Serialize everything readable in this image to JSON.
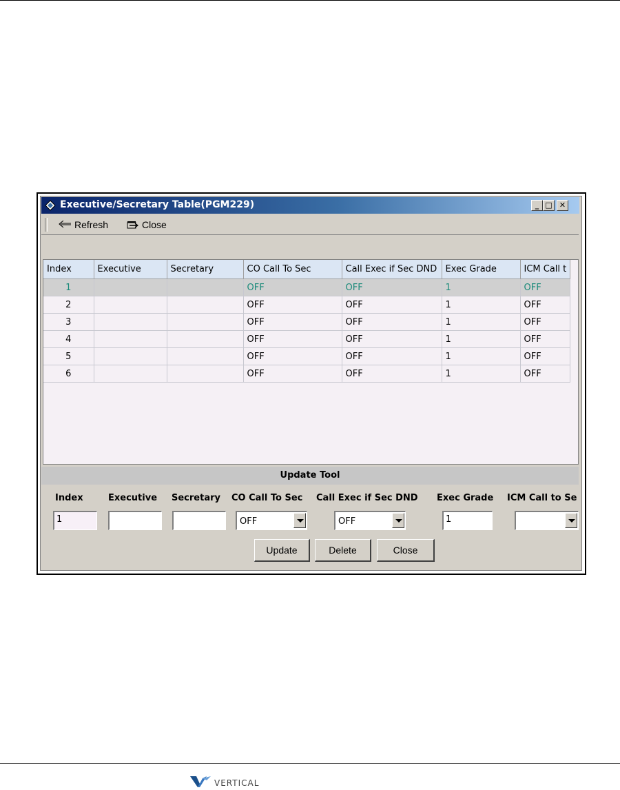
{
  "window": {
    "title": "Executive/Secretary Table(PGM229)",
    "buttons": {
      "minimize": "_",
      "maximize": "□",
      "close": "✕"
    }
  },
  "toolbar": {
    "refresh_label": "Refresh",
    "close_label": "Close"
  },
  "grid": {
    "columns": [
      "Index",
      "Executive",
      "Secretary",
      "CO Call To Sec",
      "Call Exec if Sec DND",
      "Exec Grade",
      "ICM Call t"
    ],
    "rows": [
      [
        "1",
        "",
        "",
        "OFF",
        "OFF",
        "1",
        "OFF"
      ],
      [
        "2",
        "",
        "",
        "OFF",
        "OFF",
        "1",
        "OFF"
      ],
      [
        "3",
        "",
        "",
        "OFF",
        "OFF",
        "1",
        "OFF"
      ],
      [
        "4",
        "",
        "",
        "OFF",
        "OFF",
        "1",
        "OFF"
      ],
      [
        "5",
        "",
        "",
        "OFF",
        "OFF",
        "1",
        "OFF"
      ],
      [
        "6",
        "",
        "",
        "OFF",
        "OFF",
        "1",
        "OFF"
      ]
    ],
    "selected_row": 1,
    "selected_color": "#1a8a7a"
  },
  "update_tool": {
    "title": "Update Tool",
    "labels": {
      "index": "Index",
      "executive": "Executive",
      "secretary": "Secretary",
      "co_call_to_sec": "CO Call To Sec",
      "call_exec_if_sec_dnd": "Call Exec if Sec DND",
      "exec_grade": "Exec Grade",
      "icm_call_to_sec": "ICM Call to Se"
    },
    "values": {
      "index": "1",
      "executive": "",
      "secretary": "",
      "co_call_to_sec": "OFF",
      "call_exec_if_sec_dnd": "OFF",
      "exec_grade": "1",
      "icm_call_to_sec": ""
    },
    "buttons": {
      "update": "Update",
      "delete": "Delete",
      "close": "Close"
    }
  },
  "footer": {
    "logo_text": "VERTICAL"
  }
}
